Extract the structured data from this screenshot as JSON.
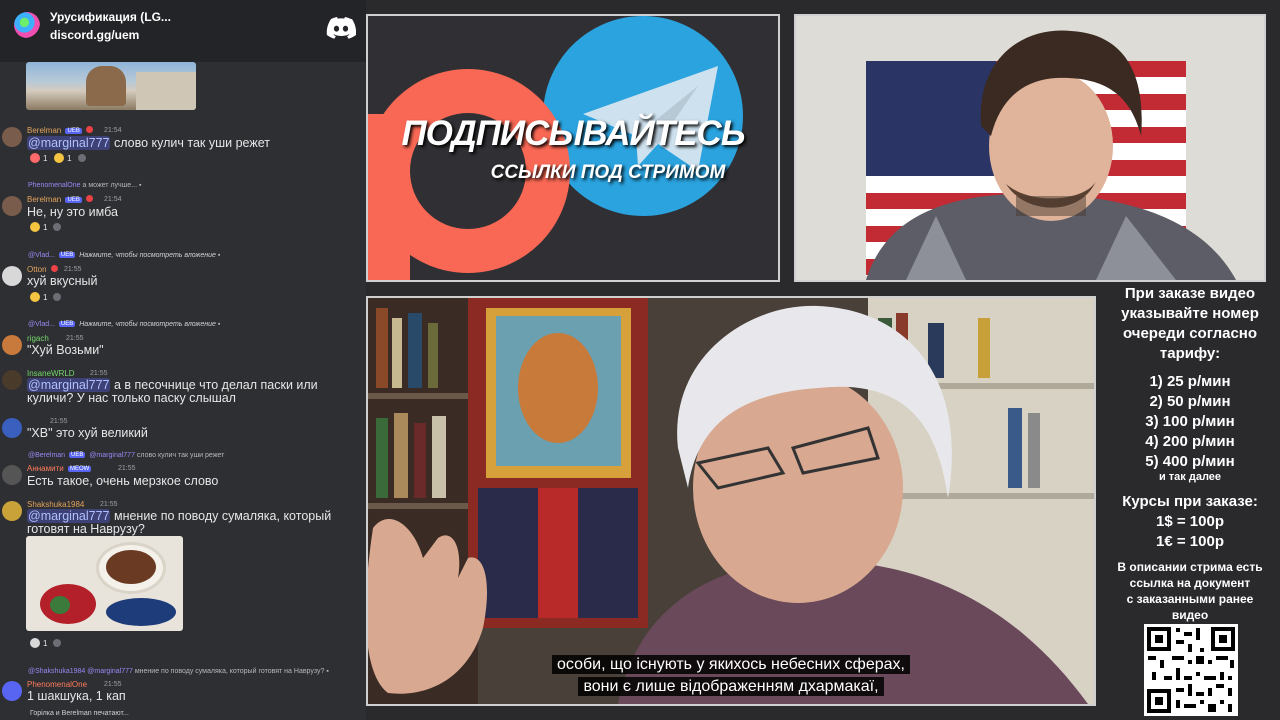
{
  "chat": {
    "server_name": "Урусификация (LG...",
    "server_invite": "discord.gg/uem",
    "icons": [
      "server-icon",
      "discord-logo-icon"
    ],
    "messages": [
      {
        "author": "Berelman",
        "time": "21:54",
        "mention": "@marginal777",
        "text": "слово кулич так уши режет",
        "reactions": [
          "1",
          "1"
        ]
      },
      {
        "reply_author": "PhenomenalOne",
        "reply_text": "а может лучше...",
        "author": "Berelman",
        "time": "21:54",
        "text": "Не, ну это имба",
        "reactions": [
          "1"
        ]
      },
      {
        "reply_author": "@Vlad...",
        "reply_text": "Нажмите, чтобы посмотреть вложение",
        "author": "Otton",
        "time": "21:55",
        "text": "хуй вкусный",
        "reactions": [
          "1"
        ]
      },
      {
        "reply_author": "@Vlad...",
        "reply_text": "Нажмите, чтобы посмотреть вложение",
        "author": "rigach",
        "time": "21:55",
        "text": "\"Хуй Возьми\""
      },
      {
        "author": "InsaneWRLD",
        "time": "21:55",
        "mention": "@marginal777",
        "text_line1": "а в песочнице что делал паски или",
        "text_line2": "куличи? У нас только паску слышал"
      },
      {
        "time": "21:55",
        "text": "\"ХВ\" это хуй великий"
      },
      {
        "reply_author": "@Berelman",
        "reply_mention": "@marginal777",
        "reply_text": "слово кулич так уши режет",
        "author": "Аннамити",
        "time": "21:55",
        "text": "Есть такое, очень мерзкое слово"
      },
      {
        "author": "Shakshuka1984",
        "time": "21:55",
        "mention": "@marginal777",
        "text_line1": "мнение по поводу сумаляка, который",
        "text_line2": "готовят на Наврузу?",
        "reactions": [
          "1"
        ]
      },
      {
        "reply_author": "@Shakshuka1984",
        "reply_mention": "@marginal777",
        "reply_text": "мнение по поводу сумаляка, который готовят на Наврузу?",
        "author": "PhenomenalOne",
        "time": "21:55",
        "text": "1 шакшука, 1 кап"
      }
    ],
    "typing": "Горілка и Berelman печатают..."
  },
  "promo": {
    "title": "ПОДПИСЫВАЙТЕСЬ",
    "subtitle": "ССЫЛКИ ПОД СТРИМОМ",
    "icons": [
      "patreon-logo-icon",
      "telegram-logo-icon"
    ]
  },
  "video": {
    "subtitle_line1": "особи, що існують у якихось небесних сферах,",
    "subtitle_line2": "вони є лише відображенням дхармакаї,"
  },
  "info": {
    "heading_l1": "При заказе видео",
    "heading_l2": "указывайте номер",
    "heading_l3": "очереди согласно",
    "heading_l4": "тарифу:",
    "tariffs": [
      "1) 25 р/мин",
      "2) 50 р/мин",
      "3) 100 р/мин",
      "4) 200 р/мин",
      "5) 400 р/мин"
    ],
    "etc": "и так далее",
    "rates_title": "Курсы при заказе:",
    "rate_usd": "1$ = 100р",
    "rate_eur": "1€ = 100р",
    "desc_l1": "В описании стрима есть",
    "desc_l2": "ссылка на документ",
    "desc_l3": "с заказанными ранее",
    "desc_l4": "видео"
  },
  "colors": {
    "chat_bg": "#2e2f33",
    "chat_header_bg": "#232428",
    "mention_bg": "#5865f2",
    "username": "#e3a35c",
    "patreon": "#f96854",
    "telegram": "#2aa3df",
    "frame_border": "#cfcfcf"
  }
}
